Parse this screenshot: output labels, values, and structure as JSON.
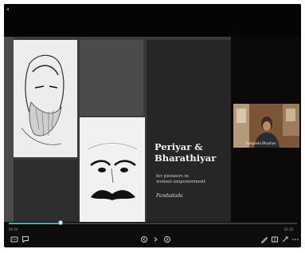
{
  "slide": {
    "title": "Periyar &\nBharathiyar",
    "subtitle": "for pioneers in\nwomen empowerment",
    "author": "Pandudada"
  },
  "video": {
    "participant_name": "Sangeeta Bhushan"
  },
  "player": {
    "time_elapsed": "00:34",
    "time_total": "01:02",
    "progress": 0.18
  },
  "icons": {
    "back": "back-arrow-icon",
    "captions": "captions-icon",
    "notes": "comment-icon",
    "previous": "previous-icon",
    "next": "next-icon",
    "draw": "pen-icon",
    "layout": "layout-icon",
    "fullscreen": "fullscreen-icon",
    "more": "more-icon"
  },
  "colors": {
    "accent": "#56a6b4"
  }
}
